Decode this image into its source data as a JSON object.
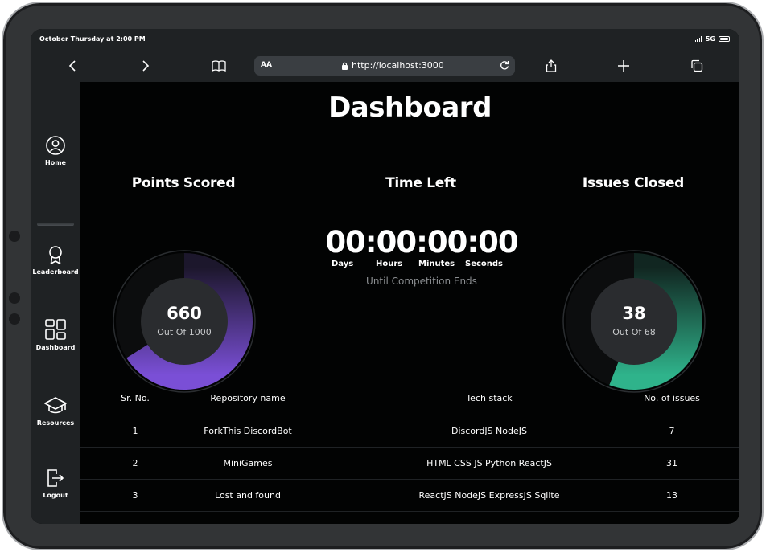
{
  "status_bar": {
    "time": "October Thursday at 2:00 PM",
    "network": "5G"
  },
  "browser": {
    "url_aa": "AA",
    "url": "http://localhost:3000"
  },
  "sidebar": {
    "items": [
      {
        "label": "Home",
        "icon": "user-circle-icon"
      },
      {
        "label": "Leaderboard",
        "icon": "award-icon"
      },
      {
        "label": "Dashboard",
        "icon": "dashboard-grid-icon"
      },
      {
        "label": "Resources",
        "icon": "graduation-cap-icon"
      },
      {
        "label": "Logout",
        "icon": "logout-icon"
      }
    ]
  },
  "dashboard": {
    "title": "Dashboard",
    "points": {
      "title": "Points Scored",
      "value": "660",
      "sub": "Out Of 1000",
      "fraction": 0.66,
      "color": "#7a4fd6"
    },
    "timer": {
      "title": "Time Left",
      "digits": "00:00:00:00",
      "units": [
        "Days",
        "Hours",
        "Minutes",
        "Seconds"
      ],
      "until": "Until Competition Ends"
    },
    "issues": {
      "title": "Issues Closed",
      "value": "38",
      "sub": "Out Of 68",
      "fraction": 0.5588,
      "color": "#2fb38b"
    }
  },
  "table": {
    "headers": [
      "Sr. No.",
      "Repository name",
      "Tech stack",
      "No. of issues"
    ],
    "rows": [
      {
        "sr": "1",
        "repo": "ForkThis DiscordBot",
        "stack": "DiscordJS NodeJS",
        "issues": "7"
      },
      {
        "sr": "2",
        "repo": "MiniGames",
        "stack": "HTML CSS JS Python ReactJS",
        "issues": "31"
      },
      {
        "sr": "3",
        "repo": "Lost and found",
        "stack": "ReactJS NodeJS ExpressJS Sqlite",
        "issues": "13"
      }
    ]
  }
}
